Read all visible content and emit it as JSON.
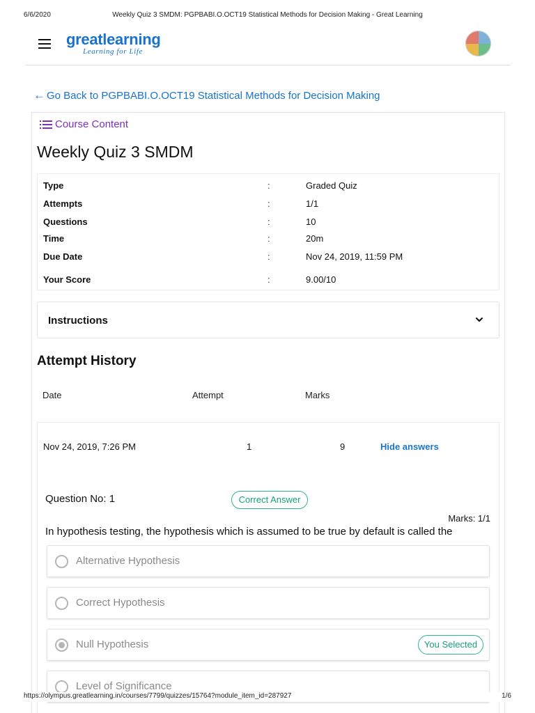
{
  "print_header": {
    "date": "6/6/2020",
    "title": "Weekly Quiz 3 SMDM: PGPBABI.O.OCT19 Statistical Methods for Decision Making - Great Learning"
  },
  "header": {
    "brand": "greatlearning",
    "tagline": "Learning for Life"
  },
  "nav": {
    "go_back": "Go Back to PGPBABI.O.OCT19 Statistical Methods for Decision Making",
    "course_content": "Course Content"
  },
  "quiz": {
    "title": "Weekly Quiz 3 SMDM",
    "info": [
      {
        "label": "Type",
        "value": "Graded Quiz"
      },
      {
        "label": "Attempts",
        "value": "1/1"
      },
      {
        "label": "Questions",
        "value": "10"
      },
      {
        "label": "Time",
        "value": "20m"
      },
      {
        "label": "Due Date",
        "value": "Nov 24, 2019, 11:59 PM"
      },
      {
        "label": "Your Score",
        "value": "9.00/10"
      }
    ],
    "separator": ":",
    "instructions_label": "Instructions"
  },
  "history": {
    "title": "Attempt History",
    "headers": {
      "date": "Date",
      "attempt": "Attempt",
      "marks": "Marks"
    },
    "row": {
      "date": "Nov 24, 2019, 7:26 PM",
      "attempt": "1",
      "marks": "9",
      "action": "Hide answers"
    }
  },
  "question": {
    "number_label": "Question No: 1",
    "status": "Correct Answer",
    "marks": "Marks: 1/1",
    "text": "In hypothesis testing, the hypothesis which is assumed to be true by default is called the",
    "options": [
      {
        "label": "Alternative Hypothesis",
        "selected": false
      },
      {
        "label": "Correct Hypothesis",
        "selected": false
      },
      {
        "label": "Null Hypothesis",
        "selected": true,
        "badge": "You Selected"
      },
      {
        "label": "Level of Significance",
        "selected": false
      }
    ]
  },
  "print_footer": {
    "url": "https://olympus.greatlearning.in/courses/7799/quizzes/15764?module_item_id=287927",
    "page": "1/6"
  },
  "colors": {
    "brand_blue": "#1a73c8",
    "accent_purple": "#7b2fbf",
    "success_green": "#17a079"
  }
}
